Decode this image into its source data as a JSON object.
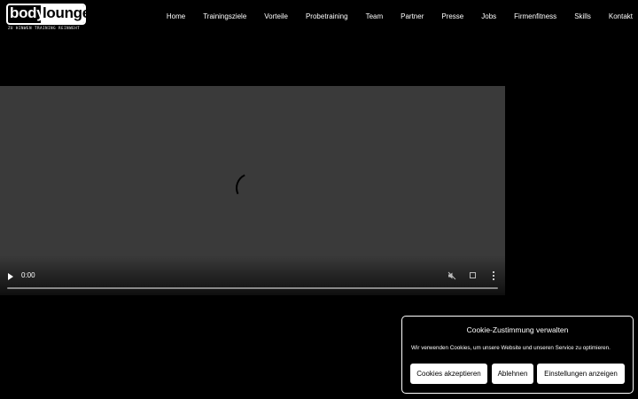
{
  "logo": {
    "part1": "body",
    "part2": "lounge",
    "tagline": "ZU HINWEN TRAINING REINWEHT"
  },
  "nav": {
    "items": [
      "Home",
      "Trainingsziele",
      "Vorteile",
      "Probetraining",
      "Team",
      "Partner",
      "Presse",
      "Jobs",
      "Firmenfitness",
      "Skills",
      "Kontakt"
    ]
  },
  "video": {
    "time": "0:00",
    "progress": 0
  },
  "cookie": {
    "title": "Cookie-Zustimmung verwalten",
    "text": "Wir verwenden Cookies, um unsere Website und unseren Service zu optimieren.",
    "accept_label": "Cookies akzeptieren",
    "deny_label": "Ablehnen",
    "settings_label": "Einstellungen anzeigen"
  }
}
